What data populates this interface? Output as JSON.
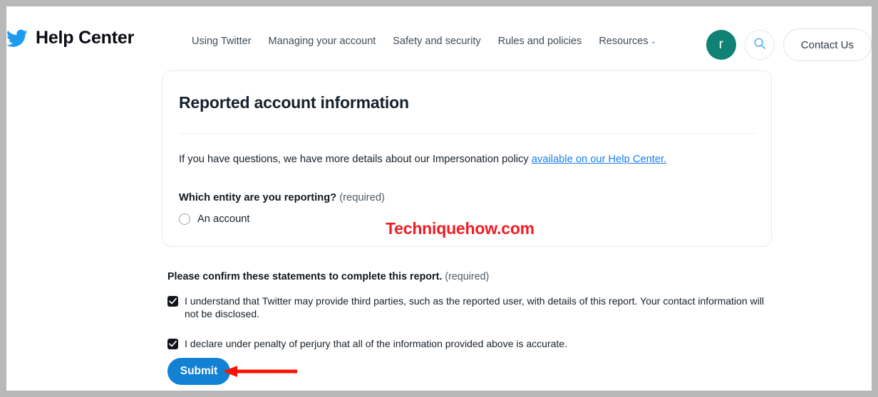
{
  "header": {
    "logo_icon": "twitter-bird-icon",
    "brand_title": "Help Center",
    "nav_items": [
      {
        "label": "Using Twitter",
        "has_caret": false
      },
      {
        "label": "Managing your account",
        "has_caret": false
      },
      {
        "label": "Safety and security",
        "has_caret": false
      },
      {
        "label": "Rules and policies",
        "has_caret": false
      },
      {
        "label": "Resources",
        "has_caret": true,
        "caret": "⌄"
      }
    ],
    "avatar_initial": "r",
    "avatar_color": "#0f8274",
    "search_icon": "search-icon",
    "search_icon_color": "#5cb3f7",
    "contact_button_label": "Contact Us"
  },
  "card": {
    "title": "Reported account information",
    "body_text_before_link": "If you have questions, we have more details about our Impersonation policy ",
    "body_link_text": "available on our Help Center.",
    "link_color": "#1a7ff0",
    "question_label": "Which entity are you reporting?",
    "question_required": "(required)",
    "radio_options": [
      {
        "label": "An account",
        "checked": false
      }
    ]
  },
  "watermark": {
    "text": "Techniquehow.com",
    "color": "#f01c23"
  },
  "confirm": {
    "title": "Please confirm these statements to complete this report.",
    "title_required": "(required)",
    "statements": [
      {
        "label": "I understand that Twitter may provide third parties, such as the reported user, with details of this report. Your contact information will not be disclosed.",
        "checked": true
      },
      {
        "label": "I declare under penalty of perjury that all of the information provided above is accurate.",
        "checked": true
      }
    ]
  },
  "submit": {
    "label": "Submit",
    "color": "#1281d4"
  },
  "annotation": {
    "arrow_color": "#fc1100",
    "arrow_direction": "left"
  }
}
